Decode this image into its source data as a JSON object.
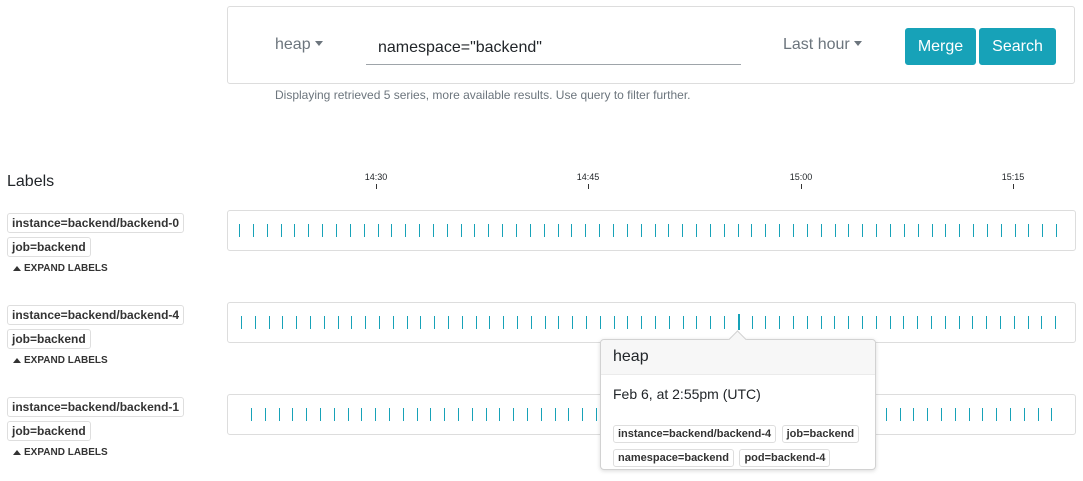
{
  "search": {
    "profile_type": "heap",
    "query_value": "namespace=\"backend\"",
    "time_range": "Last hour",
    "merge_label": "Merge",
    "search_label": "Search",
    "info": "Displaying retrieved 5 series, more available results. Use query to filter further."
  },
  "labels_heading": "Labels",
  "time_axis": [
    "14:30",
    "14:45",
    "15:00",
    "15:15"
  ],
  "expand_label": "EXPAND LABELS",
  "series": [
    {
      "labels": [
        "instance=backend/backend-0",
        "job=backend"
      ]
    },
    {
      "labels": [
        "instance=backend/backend-4",
        "job=backend"
      ]
    },
    {
      "labels": [
        "instance=backend/backend-1",
        "job=backend"
      ]
    }
  ],
  "tooltip": {
    "title": "heap",
    "time": "Feb 6, at 2:55pm (UTC)",
    "labels": [
      "instance=backend/backend-4",
      "job=backend",
      "namespace=backend",
      "pod=backend-4"
    ]
  },
  "colors": {
    "accent": "#17a2b8"
  },
  "icons": {
    "dropdown": "caret-down-icon",
    "expand": "caret-up-icon"
  }
}
